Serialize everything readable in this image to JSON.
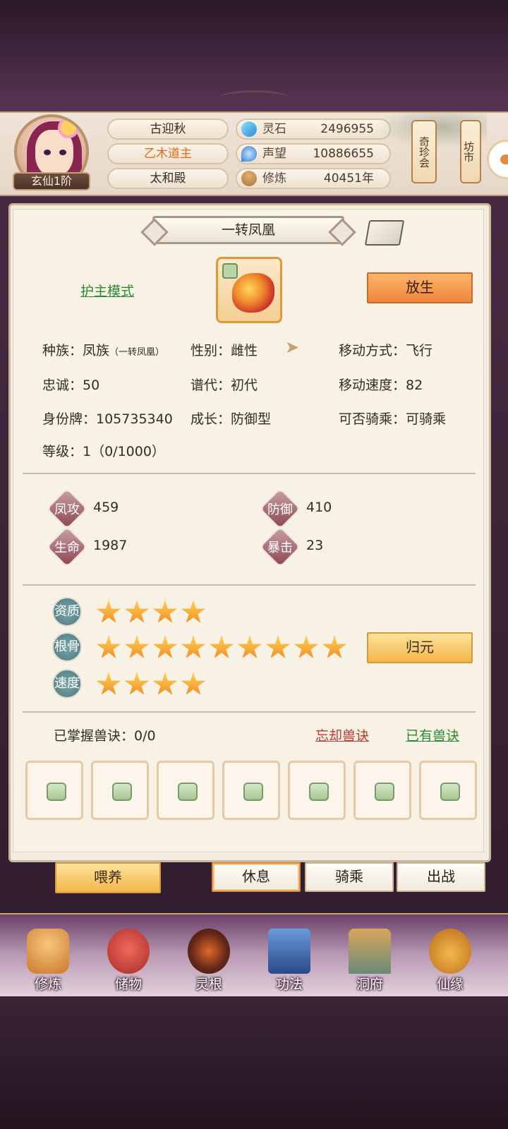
{
  "header": {
    "player_rank": "玄仙1阶",
    "name_pills": [
      "古迎秋",
      "乙木道主",
      "太和殿"
    ],
    "resources": [
      {
        "label": "灵石",
        "value": "2496955",
        "icon": "spirit-stone-icon"
      },
      {
        "label": "声望",
        "value": "10886655",
        "icon": "prestige-icon"
      },
      {
        "label": "修炼",
        "value": "40451年",
        "icon": "meditation-icon"
      }
    ],
    "side_buttons": [
      "奇珍会",
      "坊市"
    ]
  },
  "pet": {
    "title": "一转凤凰",
    "mode_link": "护主模式",
    "release_button": "放生",
    "info": {
      "race_label": "种族：",
      "race_value": "凤族",
      "race_sub": "（一转凤凰）",
      "gender": "性别：雌性",
      "move_type": "移动方式：飞行",
      "loyalty": "忠诚：50",
      "generation": "谱代：初代",
      "move_speed": "移动速度：82",
      "id_tag": "身份牌：105735340",
      "growth": "成长：防御型",
      "rideable": "可否骑乘：可骑乘",
      "level": "等级：1（0/1000）"
    },
    "attributes": [
      {
        "label": "凤攻",
        "value": "459"
      },
      {
        "label": "防御",
        "value": "410"
      },
      {
        "label": "生命",
        "value": "1987"
      },
      {
        "label": "暴击",
        "value": "23"
      }
    ],
    "star_rows": [
      {
        "label": "资质",
        "stars": 4
      },
      {
        "label": "根骨",
        "stars": 9
      },
      {
        "label": "速度",
        "stars": 4
      }
    ],
    "reset_button": "归元",
    "skills": {
      "mastered": "已掌握兽诀：0/0",
      "forget_link": "忘却兽诀",
      "owned_link": "已有兽诀",
      "slot_count": 7
    }
  },
  "actions": {
    "feed": "喂养",
    "rest": "休息",
    "ride": "骑乘",
    "battle": "出战"
  },
  "nav": [
    "修炼",
    "储物",
    "灵根",
    "功法",
    "洞府",
    "仙缘"
  ],
  "colors": {
    "accent_orange": "#f0853d",
    "link_green": "#2b8a2f",
    "link_red": "#c0392b"
  }
}
